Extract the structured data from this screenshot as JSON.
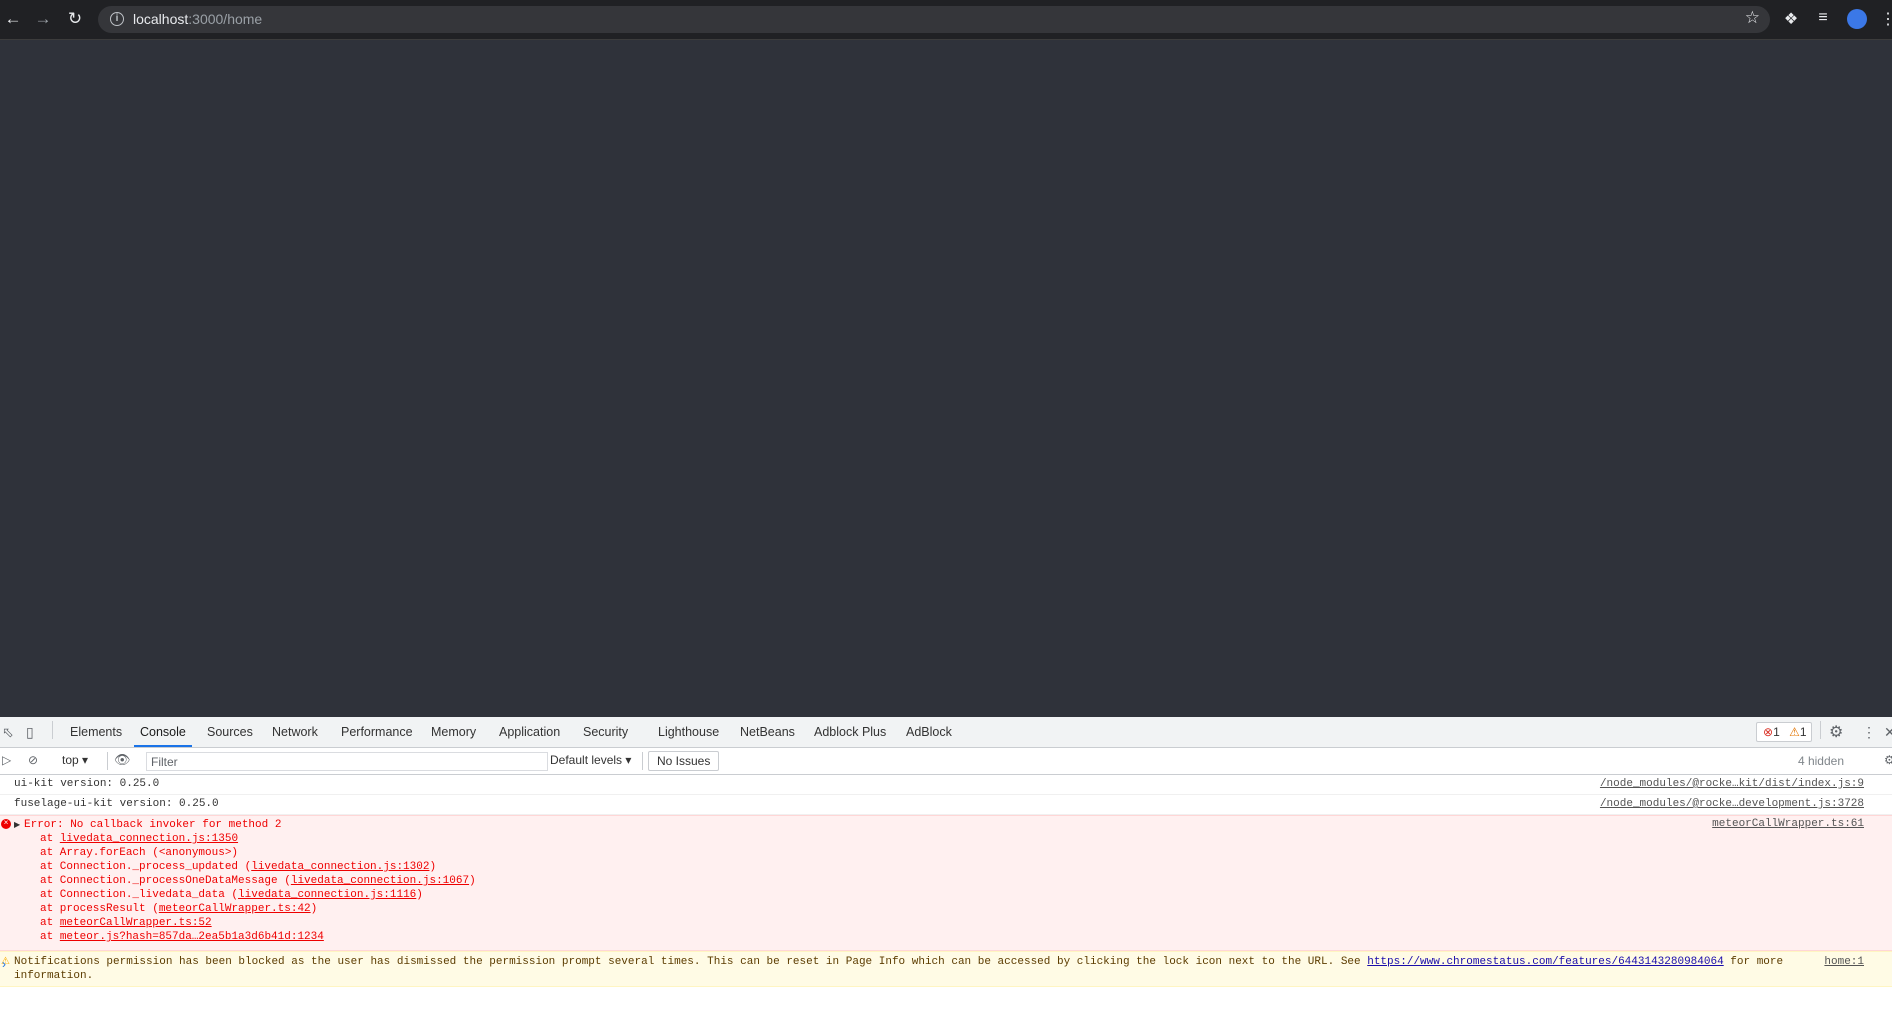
{
  "browser": {
    "url_host": "localhost",
    "url_path": ":3000/home",
    "back_icon": "arrow-left",
    "forward_icon": "arrow-right",
    "reload_icon": "reload",
    "bookmark_icon": "star"
  },
  "devtools": {
    "tabs": [
      "Elements",
      "Console",
      "Sources",
      "Network",
      "Performance",
      "Memory",
      "Application",
      "Security",
      "Lighthouse",
      "NetBeans",
      "Adblock Plus",
      "AdBlock"
    ],
    "active_tab": "Console",
    "error_count": "1",
    "warning_count": "1",
    "toolbar": {
      "context": "top",
      "filter_placeholder": "Filter",
      "levels": "Default levels",
      "no_issues": "No Issues",
      "hidden": "4 hidden"
    },
    "messages": {
      "log1": {
        "text": "ui-kit version: 0.25.0",
        "source": "/node_modules/@rocke…kit/dist/index.js:9"
      },
      "log2": {
        "text": "fuselage-ui-kit version: 0.25.0",
        "source": "/node_modules/@rocke…development.js:3728"
      },
      "error": {
        "title": "Error: No callback invoker for method 2",
        "source": "meteorCallWrapper.ts:61",
        "stack": [
          {
            "prefix": "    at ",
            "link": "livedata_connection.js:1350",
            "suffix": ""
          },
          {
            "prefix": "    at Array.forEach (<anonymous>)",
            "link": "",
            "suffix": ""
          },
          {
            "prefix": "    at Connection._process_updated (",
            "link": "livedata_connection.js:1302",
            "suffix": ")"
          },
          {
            "prefix": "    at Connection._processOneDataMessage (",
            "link": "livedata_connection.js:1067",
            "suffix": ")"
          },
          {
            "prefix": "    at Connection._livedata_data (",
            "link": "livedata_connection.js:1116",
            "suffix": ")"
          },
          {
            "prefix": "    at processResult (",
            "link": "meteorCallWrapper.ts:42",
            "suffix": ")"
          },
          {
            "prefix": "    at ",
            "link": "meteorCallWrapper.ts:52",
            "suffix": ""
          },
          {
            "prefix": "    at ",
            "link": "meteor.js?hash=857da…2ea5b1a3d6b41d:1234",
            "suffix": ""
          }
        ]
      },
      "warning": {
        "text": "Notifications permission has been blocked as the user has dismissed the permission prompt several times. This can be reset in Page Info which can be accessed by clicking the lock icon next to the URL. See ",
        "link": "https://www.chromestatus.com/features/6443143280984064",
        "text_after": " for more",
        "text_line2": "information.",
        "source": "home:1"
      }
    }
  }
}
